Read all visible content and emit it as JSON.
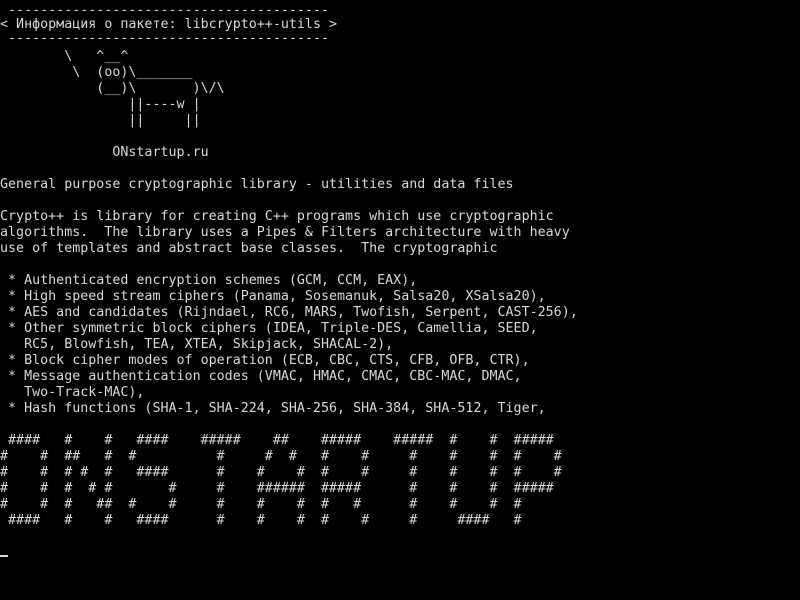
{
  "colors": {
    "background": "#000000",
    "text": "#d8d8d8"
  },
  "banner": {
    "top_rule": " ----------------------------------------",
    "title": "< Информация о пакете: libcrypto++-utils >",
    "bottom_rule": " ----------------------------------------"
  },
  "cow": [
    "        \\   ^__^",
    "         \\  (oo)\\_______",
    "            (__)\\       )\\/\\",
    "                ||----w |",
    "                ||     ||"
  ],
  "site": "              ONstartup.ru",
  "summary": "General purpose cryptographic library - utilities and data files",
  "description": [
    "Crypto++ is library for creating C++ programs which use cryptographic",
    "algorithms.  The library uses a Pipes & Filters architecture with heavy",
    "use of templates and abstract base classes.  The cryptographic"
  ],
  "features": [
    " * Authenticated encryption schemes (GCM, CCM, EAX),",
    " * High speed stream ciphers (Panama, Sosemanuk, Salsa20, XSalsa20),",
    " * AES and candidates (Rijndael, RC6, MARS, Twofish, Serpent, CAST-256),",
    " * Other symmetric block ciphers (IDEA, Triple-DES, Camellia, SEED,",
    "   RC5, Blowfish, TEA, XTEA, Skipjack, SHACAL-2),",
    " * Block cipher modes of operation (ECB, CBC, CTS, CFB, OFB, CTR),",
    " * Message authentication codes (VMAC, HMAC, CMAC, CBC-MAC, DMAC,",
    "   Two-Track-MAC),",
    " * Hash functions (SHA-1, SHA-224, SHA-256, SHA-384, SHA-512, Tiger,"
  ],
  "ascii_art": [
    " ####   #    #   ####    #####    ##    #####    #####  #    #  #####",
    "#    #  ##   #  #          #     #  #   #    #     #    #    #  #    #",
    "#    #  # #  #   ####      #    #    #  #    #     #    #    #  #    #",
    "#    #  #  # #       #     #    ######  #####      #    #    #  #####",
    "#    #  #   ##  #    #     #    #    #  #   #      #    #    #  #",
    " ####   #    #   ####      #    #    #  #    #     #     ####   #"
  ]
}
